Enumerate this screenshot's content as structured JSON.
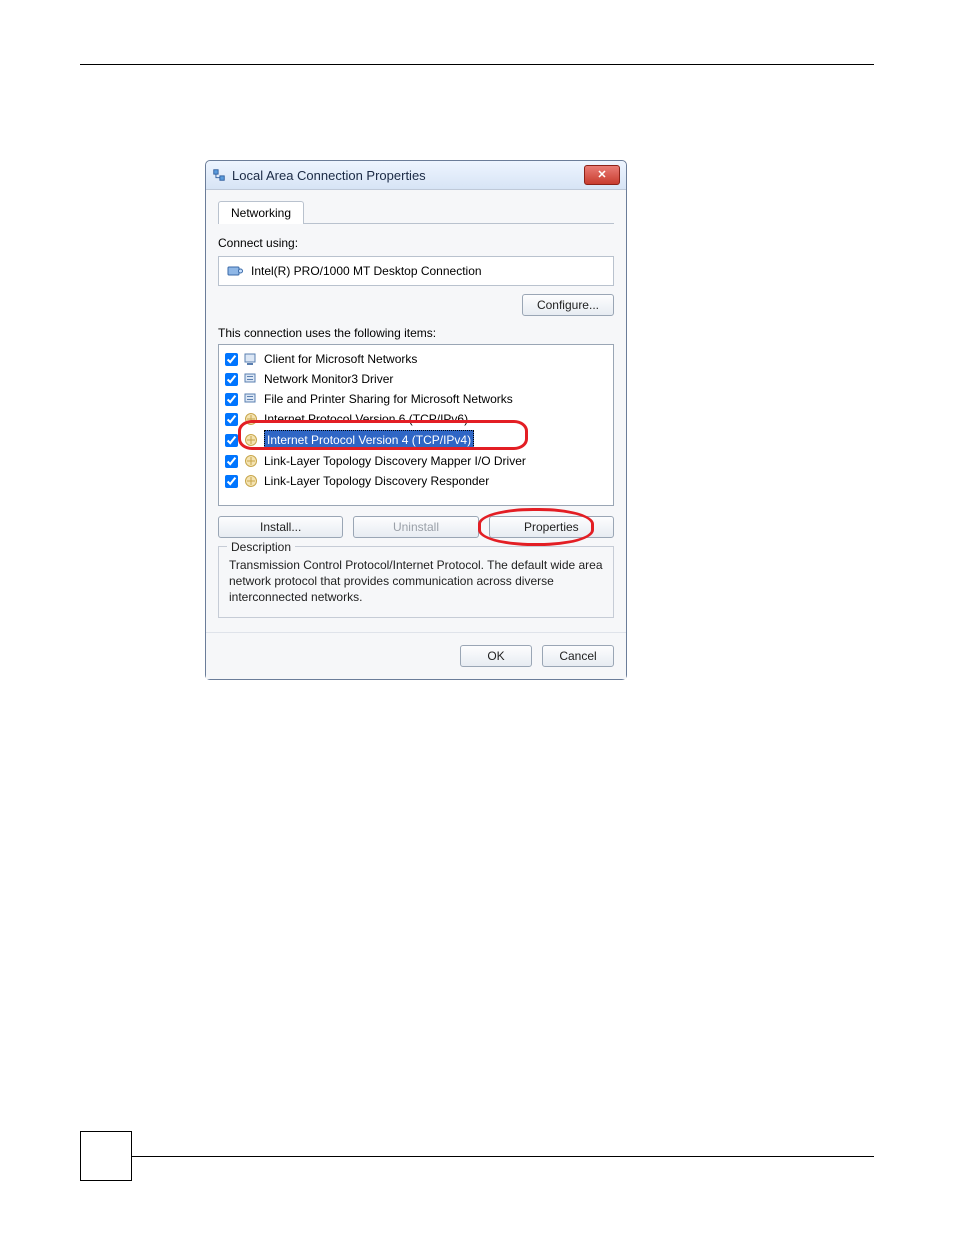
{
  "window": {
    "title": "Local Area Connection Properties",
    "close_label": "✕"
  },
  "tabs": {
    "networking": "Networking"
  },
  "connect_using_label": "Connect using:",
  "adapter_name": "Intel(R) PRO/1000 MT Desktop Connection",
  "configure_btn": "Configure...",
  "items_label": "This connection uses the following items:",
  "items": [
    {
      "label": "Client for Microsoft Networks",
      "checked": true,
      "kind": "client"
    },
    {
      "label": "Network Monitor3 Driver",
      "checked": true,
      "kind": "service"
    },
    {
      "label": "File and Printer Sharing for Microsoft Networks",
      "checked": true,
      "kind": "service"
    },
    {
      "label": "Internet Protocol Version 6 (TCP/IPv6)",
      "checked": true,
      "kind": "protocol"
    },
    {
      "label": "Internet Protocol Version 4 (TCP/IPv4)",
      "checked": true,
      "kind": "protocol",
      "selected": true
    },
    {
      "label": "Link-Layer Topology Discovery Mapper I/O Driver",
      "checked": true,
      "kind": "protocol"
    },
    {
      "label": "Link-Layer Topology Discovery Responder",
      "checked": true,
      "kind": "protocol"
    }
  ],
  "buttons": {
    "install": "Install...",
    "uninstall": "Uninstall",
    "properties": "Properties"
  },
  "description": {
    "legend": "Description",
    "text": "Transmission Control Protocol/Internet Protocol. The default wide area network protocol that provides communication across diverse interconnected networks."
  },
  "footer": {
    "ok": "OK",
    "cancel": "Cancel"
  },
  "annotations": {
    "highlight_item_index": 4,
    "highlight_button": "properties"
  }
}
